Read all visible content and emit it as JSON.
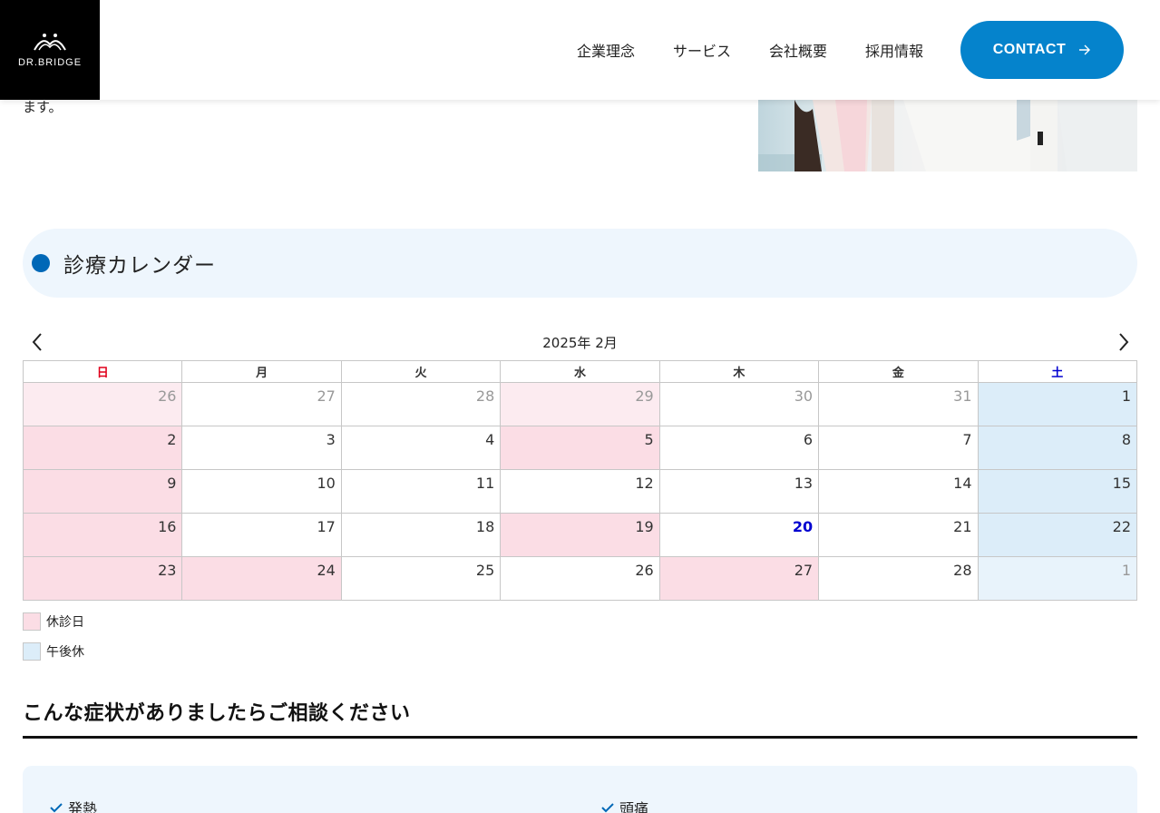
{
  "header": {
    "logo_text": "DR.BRIDGE",
    "nav": [
      "企業理念",
      "サービス",
      "会社概要",
      "採用情報"
    ],
    "contact_label": "CONTACT"
  },
  "intro": {
    "text_tail": "ます。"
  },
  "section": {
    "title": "診療カレンダー"
  },
  "calendar": {
    "title": "2025年 2月",
    "weekdays": [
      "日",
      "月",
      "火",
      "水",
      "木",
      "金",
      "土"
    ],
    "weeks": [
      [
        {
          "day": "26",
          "status": "closed",
          "other": true
        },
        {
          "day": "27",
          "status": "open",
          "other": true
        },
        {
          "day": "28",
          "status": "open",
          "other": true
        },
        {
          "day": "29",
          "status": "closed",
          "other": true
        },
        {
          "day": "30",
          "status": "open",
          "other": true
        },
        {
          "day": "31",
          "status": "open",
          "other": true
        },
        {
          "day": "1",
          "status": "afternoon",
          "other": false
        }
      ],
      [
        {
          "day": "2",
          "status": "closed",
          "other": false
        },
        {
          "day": "3",
          "status": "open",
          "other": false
        },
        {
          "day": "4",
          "status": "open",
          "other": false
        },
        {
          "day": "5",
          "status": "closed",
          "other": false
        },
        {
          "day": "6",
          "status": "open",
          "other": false
        },
        {
          "day": "7",
          "status": "open",
          "other": false
        },
        {
          "day": "8",
          "status": "afternoon",
          "other": false
        }
      ],
      [
        {
          "day": "9",
          "status": "closed",
          "other": false
        },
        {
          "day": "10",
          "status": "open",
          "other": false
        },
        {
          "day": "11",
          "status": "open",
          "other": false
        },
        {
          "day": "12",
          "status": "open",
          "other": false
        },
        {
          "day": "13",
          "status": "open",
          "other": false
        },
        {
          "day": "14",
          "status": "open",
          "other": false
        },
        {
          "day": "15",
          "status": "afternoon",
          "other": false
        }
      ],
      [
        {
          "day": "16",
          "status": "closed",
          "other": false
        },
        {
          "day": "17",
          "status": "open",
          "other": false
        },
        {
          "day": "18",
          "status": "open",
          "other": false
        },
        {
          "day": "19",
          "status": "closed",
          "other": false
        },
        {
          "day": "20",
          "status": "open",
          "other": false,
          "today": true
        },
        {
          "day": "21",
          "status": "open",
          "other": false
        },
        {
          "day": "22",
          "status": "afternoon",
          "other": false
        }
      ],
      [
        {
          "day": "23",
          "status": "closed",
          "other": false
        },
        {
          "day": "24",
          "status": "closed",
          "other": false
        },
        {
          "day": "25",
          "status": "open",
          "other": false
        },
        {
          "day": "26",
          "status": "open",
          "other": false
        },
        {
          "day": "27",
          "status": "closed",
          "other": false
        },
        {
          "day": "28",
          "status": "open",
          "other": false
        },
        {
          "day": "1",
          "status": "afternoon",
          "other": true
        }
      ]
    ]
  },
  "legend": [
    {
      "label": "休診日",
      "color": "#fbdde5"
    },
    {
      "label": "午後休",
      "color": "#dcedf9"
    }
  ],
  "symptoms": {
    "title": "こんな症状がありましたらご相談ください",
    "items": [
      "発熱",
      "頭痛"
    ]
  },
  "colors": {
    "accent": "#0583cc",
    "dot": "#0068b7",
    "closed": "#fbdde5",
    "afternoon": "#dcedf9",
    "sunday": "#e0001b",
    "saturday": "#0000d0"
  },
  "icons": [
    "doctor-logo-icon",
    "arrow-right-icon",
    "chevron-left-icon",
    "chevron-right-icon",
    "check-icon"
  ]
}
